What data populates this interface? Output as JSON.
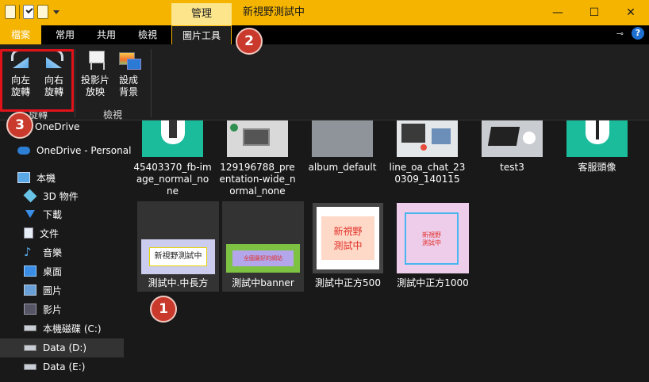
{
  "window": {
    "title": "新視野測試中",
    "context_tab_top": "管理",
    "minimize": "—",
    "maximize": "☐",
    "close": "✕"
  },
  "ribbon": {
    "tabs": [
      "檔案",
      "常用",
      "共用",
      "檢視",
      "圖片工具"
    ],
    "pin": "⊸",
    "help": "?",
    "rotate_left": [
      "向左",
      "旋轉"
    ],
    "rotate_right": [
      "向右",
      "旋轉"
    ],
    "rotate_group": "旋轉",
    "slideshow": [
      "投影片",
      "放映"
    ],
    "set_background": [
      "設成",
      "背景"
    ],
    "view_group": "檢視"
  },
  "nav": {
    "items": [
      {
        "label": "OneDrive",
        "icon": "cloud-icon"
      },
      {
        "label": "OneDrive - Personal",
        "icon": "cloud-icon"
      },
      {
        "label": "本機",
        "icon": "computer-icon"
      },
      {
        "label": "3D 物件",
        "icon": "cube-icon"
      },
      {
        "label": "下載",
        "icon": "download-icon"
      },
      {
        "label": "文件",
        "icon": "document-icon"
      },
      {
        "label": "音樂",
        "icon": "music-icon"
      },
      {
        "label": "桌面",
        "icon": "desktop-icon"
      },
      {
        "label": "圖片",
        "icon": "pictures-icon"
      },
      {
        "label": "影片",
        "icon": "videos-icon"
      },
      {
        "label": "本機磁碟 (C:)",
        "icon": "drive-icon"
      },
      {
        "label": "Data (D:)",
        "icon": "drive-icon"
      },
      {
        "label": "Data (E:)",
        "icon": "drive-icon"
      }
    ]
  },
  "files": {
    "row1": [
      {
        "name": [
          "45403370_fb-im",
          "age_normal_no",
          "ne"
        ]
      },
      {
        "name": [
          "129196788_pre",
          "entation-wide_n",
          "ormal_none"
        ]
      },
      {
        "name": [
          "album_default"
        ]
      },
      {
        "name": [
          "line_oa_chat_23",
          "0309_140115"
        ]
      },
      {
        "name": [
          "test3"
        ]
      },
      {
        "name": [
          "客服頭像"
        ]
      }
    ],
    "row2": [
      {
        "name": "測試中.中長方",
        "thumb_text": "新視野測試中"
      },
      {
        "name": "測試中banner",
        "thumb_text": "全國最好的網站"
      },
      {
        "name": "測試中正方500",
        "thumb_text": "新視野\n測試中"
      },
      {
        "name": "測試中正方1000",
        "thumb_text": "新視野\n測試中"
      }
    ]
  },
  "callouts": [
    "1",
    "2",
    "3"
  ],
  "colors": {
    "accent": "#f4b400",
    "callout": "#c93a2d",
    "highlight_box": "#e0131a"
  }
}
